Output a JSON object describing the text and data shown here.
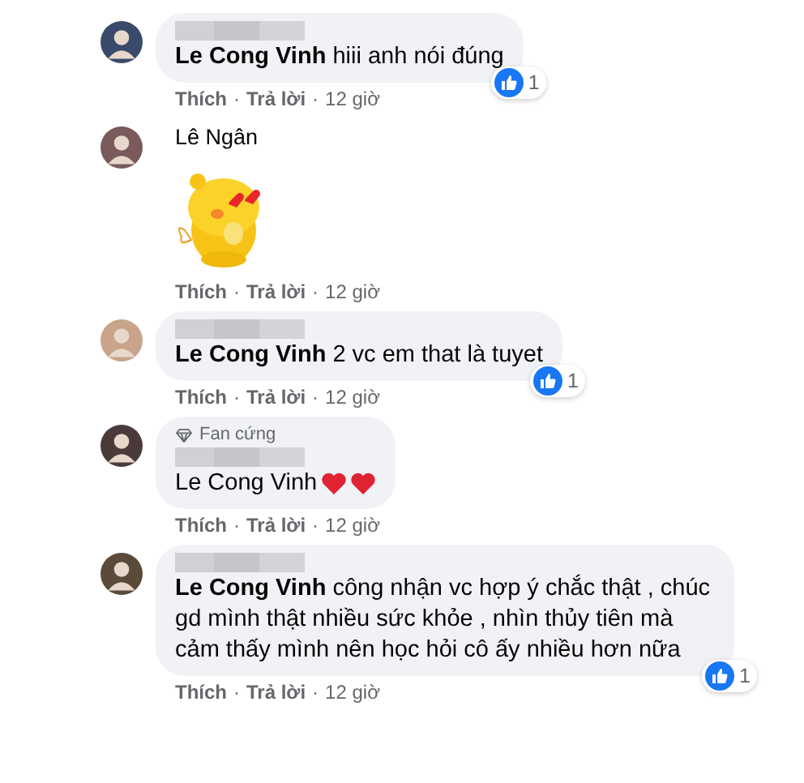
{
  "comments": [
    {
      "kind": "bubble",
      "author_blurred": true,
      "text": "**Le Cong Vinh** hiii anh nói đúng",
      "actions": {
        "like": "Thích",
        "reply": "Trả lời",
        "time": "12 giờ",
        "separator": "·"
      },
      "reactions": "1"
    },
    {
      "kind": "sticker",
      "author": "Lê Ngân",
      "actions": {
        "like": "Thích",
        "reply": "Trả lời",
        "time": "12 giờ",
        "separator": "·"
      }
    },
    {
      "kind": "bubble",
      "author_blurred": true,
      "text": "**Le Cong Vinh** 2 vc em that là tuyet",
      "actions": {
        "like": "Thích",
        "reply": "Trả lời",
        "time": "12 giờ",
        "separator": "·"
      },
      "reactions": "1"
    },
    {
      "kind": "bubble",
      "author_blurred": true,
      "badge": "Fan cứng",
      "text": "Le Cong Vinh",
      "icons": [
        {
          "kind": "heart"
        },
        {
          "kind": "heart"
        }
      ],
      "actions": {
        "like": "Thích",
        "reply": "Trả lời",
        "time": "12 giờ",
        "separator": "·"
      }
    },
    {
      "kind": "bubble",
      "author_blurred": true,
      "text": "**Le Cong Vinh** công nhận vc hợp ý chắc thật , chúc gd mình thật nhiều sức khỏe , nhìn thủy tiên mà cảm thấy mình nên học hỏi cô ấy nhiều hơn nữa",
      "actions": {
        "like": "Thích",
        "reply": "Trả lời",
        "time": "12 giờ",
        "separator": "·"
      },
      "reactions": "1"
    }
  ]
}
